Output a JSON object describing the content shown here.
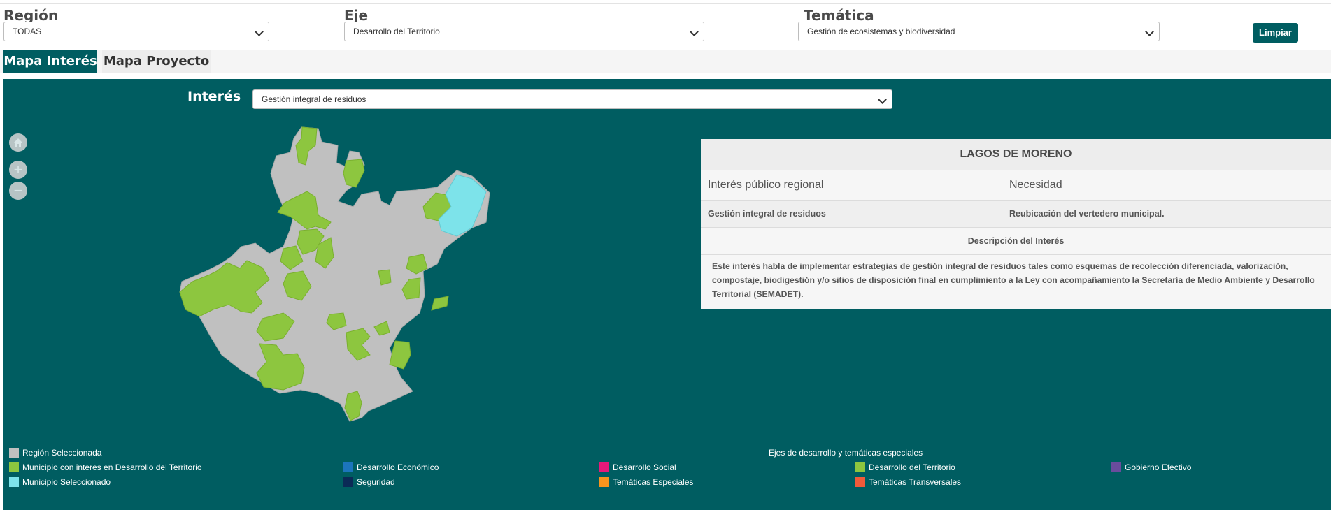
{
  "filters": {
    "region": {
      "label": "Región",
      "value": "TODAS"
    },
    "eje": {
      "label": "Eje",
      "value": "Desarrollo del Territorio"
    },
    "tematica": {
      "label": "Temática",
      "value": "Gestión de ecosistemas y biodiversidad"
    },
    "clear_label": "Limpiar"
  },
  "tabs": [
    {
      "label": "Mapa Interés"
    },
    {
      "label": "Mapa Proyecto"
    }
  ],
  "interes": {
    "label": "Interés",
    "value": "Gestión integral de residuos"
  },
  "map_controls": {
    "home": "home-icon",
    "zoom_in": "+",
    "zoom_out": "−"
  },
  "info": {
    "title": "LAGOS DE MORENO",
    "col1_header": "Interés público regional",
    "col2_header": "Necesidad",
    "col1_value": "Gestión integral de residuos",
    "col2_value": "Reubicación del vertedero municipal.",
    "desc_header": "Descripción del Interés",
    "description": "Este interés habla de implementar estrategias de gestión integral de residuos tales como esquemas de recolección diferenciada, valorización, compostaje, biodigestión y/o sitios de disposición final en cumplimiento a la Ley con acompañamiento la Secretaría de Medio Ambiente y Desarrollo Territorial (SEMADET)."
  },
  "legend": {
    "map_items": [
      {
        "label": "Región Seleccionada",
        "color": "#c0c0c0"
      },
      {
        "label": "Municipio con interes en Desarrollo del Territorio",
        "color": "#8dc63f"
      },
      {
        "label": "Municipio Seleccionado",
        "color": "#7de3ea"
      }
    ],
    "axes_title": "Ejes de desarrollo y temáticas especiales",
    "axes_items": [
      {
        "label": "Desarrollo Económico",
        "color": "#1c75bc"
      },
      {
        "label": "Seguridad",
        "color": "#0b2a56"
      },
      {
        "label": "Desarrollo Social",
        "color": "#e6197a"
      },
      {
        "label": "Temáticas Especiales",
        "color": "#f7941d"
      },
      {
        "label": "Desarrollo del Territorio",
        "color": "#8dc63f"
      },
      {
        "label": "Temáticas Transversales",
        "color": "#f15a3a"
      },
      {
        "label": "Gobierno Efectivo",
        "color": "#6a4c9c"
      }
    ]
  },
  "colors": {
    "teal": "#005d61",
    "region_gray": "#c0c0c0",
    "interest_green": "#8dc63f",
    "selected_cyan": "#7de3ea"
  }
}
